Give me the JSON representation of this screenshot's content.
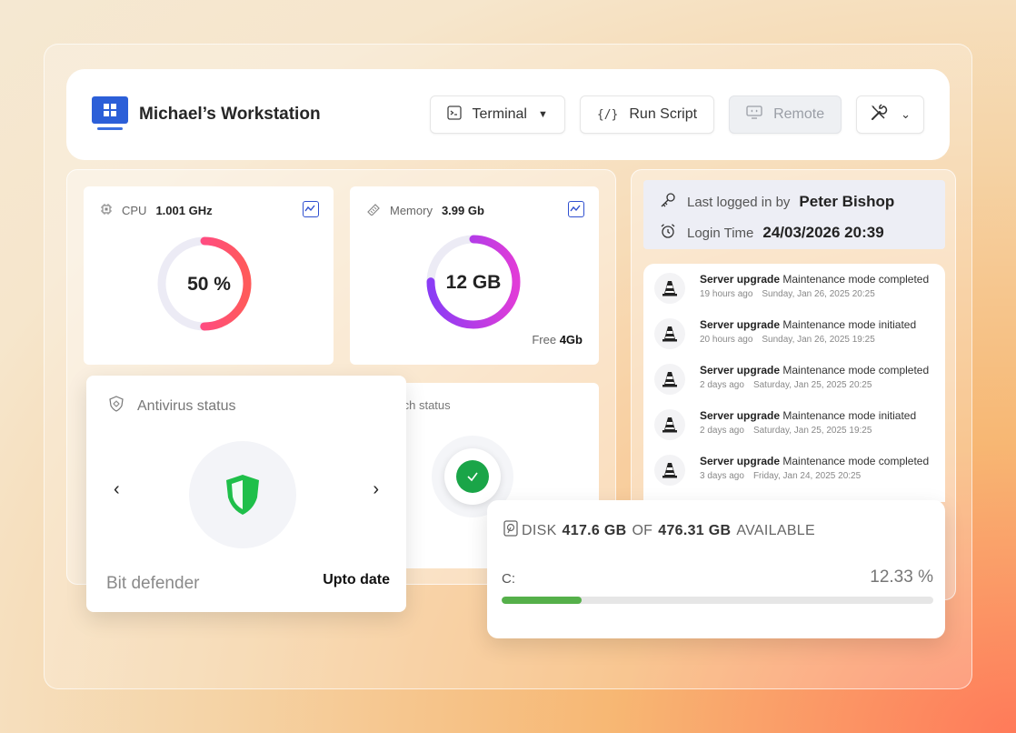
{
  "header": {
    "title": "Michael’s Workstation",
    "buttons": {
      "terminal": "Terminal",
      "run_script": "Run Script",
      "remote": "Remote"
    }
  },
  "cpu": {
    "label": "CPU",
    "value": "1.001 GHz",
    "percent_text": "50 %",
    "percent": 50
  },
  "memory": {
    "label": "Memory",
    "value": "3.99 Gb",
    "center_text": "12 GB",
    "free_label": "Free",
    "free_value": "4Gb",
    "fill_fraction": 0.75
  },
  "login": {
    "last_logged_label": "Last logged in by",
    "last_logged_user": "Peter Bishop",
    "login_time_label": "Login Time",
    "login_time_value": "24/03/2026 20:39"
  },
  "events": [
    {
      "title": "Server upgrade",
      "desc": "Maintenance mode completed",
      "ago": "19 hours ago",
      "date": "Sunday, Jan 26, 2025 20:25"
    },
    {
      "title": "Server upgrade",
      "desc": "Maintenance mode initiated",
      "ago": "20 hours ago",
      "date": "Sunday, Jan 26, 2025 19:25"
    },
    {
      "title": "Server upgrade",
      "desc": "Maintenance mode completed",
      "ago": "2 days ago",
      "date": "Saturday, Jan 25, 2025 20:25"
    },
    {
      "title": "Server upgrade",
      "desc": "Maintenance mode initiated",
      "ago": "2 days ago",
      "date": "Saturday, Jan 25, 2025 19:25"
    },
    {
      "title": "Server upgrade",
      "desc": "Maintenance mode completed",
      "ago": "3 days ago",
      "date": "Friday, Jan 24, 2025 20:25"
    }
  ],
  "antivirus": {
    "title": "Antivirus status",
    "provider": "Bit defender",
    "status": "Upto date"
  },
  "patch": {
    "title": "tch status"
  },
  "disk": {
    "label": "DISK",
    "available": "417.6 GB",
    "of": "OF",
    "total": "476.31 GB",
    "available_label": "AVAILABLE",
    "drive": "C:",
    "percent_text": "12.33 %",
    "percent": 12.33
  },
  "colors": {
    "accent_blue": "#2c5fd8",
    "cpu_gradient": [
      "#ff3fa4",
      "#ff5a5a"
    ],
    "memory_gradient": [
      "#d63fe8",
      "#8a3cf5"
    ],
    "shield_green": "#1fbf4a",
    "check_green": "#1aa548",
    "disk_bar": "#55b04a"
  },
  "icons": {
    "terminal": "terminal-icon",
    "run_script": "code-icon",
    "remote": "monitor-icon",
    "tools": "tools-icon",
    "cpu": "chip-icon",
    "memory": "ram-icon",
    "trend": "trend-icon",
    "key": "key-icon",
    "clock": "alarm-clock-icon",
    "event": "traffic-cone-icon",
    "antivirus": "virus-shield-icon",
    "shield": "shield-icon",
    "check": "check-icon",
    "disk": "hard-drive-icon"
  }
}
